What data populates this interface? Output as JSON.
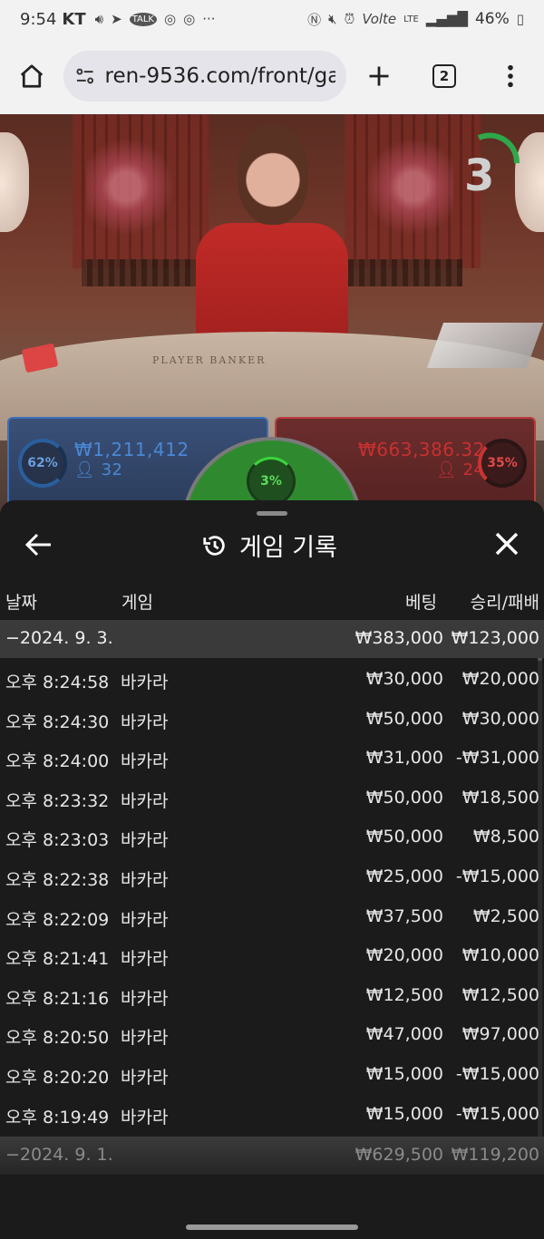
{
  "status": {
    "time": "9:54",
    "carrier": "KT",
    "battery": "46%",
    "lte": "LTE",
    "volte": "Volte"
  },
  "browser": {
    "url": "ren-9536.com/front/ga",
    "tab_count": "2"
  },
  "game": {
    "timer": "3",
    "table_text": "PLAYER      BANKER",
    "player": {
      "percent": "62%",
      "amount": "₩1,211,412",
      "count": "32"
    },
    "tie": {
      "percent": "3%"
    },
    "banker": {
      "percent": "35%",
      "amount": "₩663,386.32",
      "count": "24"
    },
    "colors": {
      "player": "#3d6fb8",
      "banker": "#b83d3d",
      "tie": "#2f8a2f"
    }
  },
  "history": {
    "title": "게임 기록",
    "columns": {
      "date": "날짜",
      "game": "게임",
      "bet": "베팅",
      "result": "승리/패배"
    },
    "groups": [
      {
        "date": "−2024. 9. 3.",
        "bet": "₩383,000",
        "result": "₩123,000",
        "rows": [
          {
            "time": "오후 8:24:58",
            "game": "바카라",
            "bet": "₩30,000",
            "result": "₩20,000"
          },
          {
            "time": "오후 8:24:30",
            "game": "바카라",
            "bet": "₩50,000",
            "result": "₩30,000"
          },
          {
            "time": "오후 8:24:00",
            "game": "바카라",
            "bet": "₩31,000",
            "result": "-₩31,000"
          },
          {
            "time": "오후 8:23:32",
            "game": "바카라",
            "bet": "₩50,000",
            "result": "₩18,500"
          },
          {
            "time": "오후 8:23:03",
            "game": "바카라",
            "bet": "₩50,000",
            "result": "₩8,500"
          },
          {
            "time": "오후 8:22:38",
            "game": "바카라",
            "bet": "₩25,000",
            "result": "-₩15,000"
          },
          {
            "time": "오후 8:22:09",
            "game": "바카라",
            "bet": "₩37,500",
            "result": "₩2,500"
          },
          {
            "time": "오후 8:21:41",
            "game": "바카라",
            "bet": "₩20,000",
            "result": "₩10,000"
          },
          {
            "time": "오후 8:21:16",
            "game": "바카라",
            "bet": "₩12,500",
            "result": "₩12,500"
          },
          {
            "time": "오후 8:20:50",
            "game": "바카라",
            "bet": "₩47,000",
            "result": "₩97,000"
          },
          {
            "time": "오후 8:20:20",
            "game": "바카라",
            "bet": "₩15,000",
            "result": "-₩15,000"
          },
          {
            "time": "오후 8:19:49",
            "game": "바카라",
            "bet": "₩15,000",
            "result": "-₩15,000"
          }
        ]
      },
      {
        "date": "−2024. 9. 1.",
        "bet": "₩629,500",
        "result": "₩119,200",
        "rows": []
      }
    ]
  }
}
